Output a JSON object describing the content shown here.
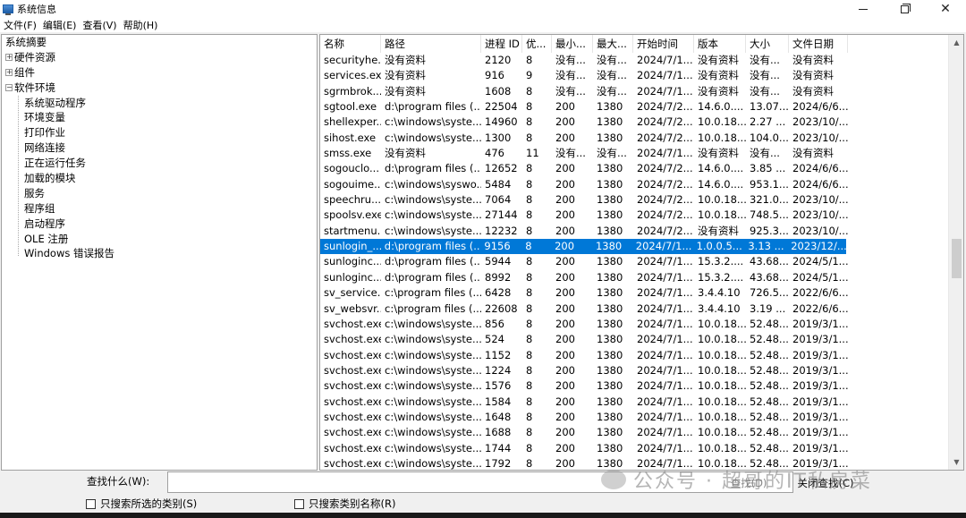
{
  "window": {
    "title": "系统信息",
    "minimize": "—",
    "restore": "❐",
    "close": "✕"
  },
  "menu": [
    "文件(F)",
    "编辑(E)",
    "查看(V)",
    "帮助(H)"
  ],
  "tree": [
    {
      "label": "系统摘要",
      "level": 0,
      "toggle": ""
    },
    {
      "label": "硬件资源",
      "level": 1,
      "toggle": "+"
    },
    {
      "label": "组件",
      "level": 1,
      "toggle": "+"
    },
    {
      "label": "软件环境",
      "level": 1,
      "toggle": "-"
    },
    {
      "label": "系统驱动程序",
      "level": 2,
      "toggle": ""
    },
    {
      "label": "环境变量",
      "level": 2,
      "toggle": ""
    },
    {
      "label": "打印作业",
      "level": 2,
      "toggle": ""
    },
    {
      "label": "网络连接",
      "level": 2,
      "toggle": ""
    },
    {
      "label": "正在运行任务",
      "level": 2,
      "toggle": ""
    },
    {
      "label": "加载的模块",
      "level": 2,
      "toggle": ""
    },
    {
      "label": "服务",
      "level": 2,
      "toggle": ""
    },
    {
      "label": "程序组",
      "level": 2,
      "toggle": ""
    },
    {
      "label": "启动程序",
      "level": 2,
      "toggle": ""
    },
    {
      "label": "OLE 注册",
      "level": 2,
      "toggle": ""
    },
    {
      "label": "Windows 错误报告",
      "level": 2,
      "toggle": ""
    }
  ],
  "columns": [
    "名称",
    "路径",
    "进程 ID",
    "优...",
    "最小...",
    "最大...",
    "开始时间",
    "版本",
    "大小",
    "文件日期"
  ],
  "rows": [
    [
      "securityhe...",
      "没有资料",
      "2120",
      "8",
      "没有...",
      "没有...",
      "2024/7/1...",
      "没有资料",
      "没有...",
      "没有资料"
    ],
    [
      "services.exe",
      "没有资料",
      "916",
      "9",
      "没有...",
      "没有...",
      "2024/7/1...",
      "没有资料",
      "没有...",
      "没有资料"
    ],
    [
      "sgrmbrok...",
      "没有资料",
      "1608",
      "8",
      "没有...",
      "没有...",
      "2024/7/1...",
      "没有资料",
      "没有...",
      "没有资料"
    ],
    [
      "sgtool.exe",
      "d:\\program files (...",
      "22504",
      "8",
      "200",
      "1380",
      "2024/7/2...",
      "14.6.0....",
      "13.07...",
      "2024/6/6..."
    ],
    [
      "shellexper...",
      "c:\\windows\\syste...",
      "14960",
      "8",
      "200",
      "1380",
      "2024/7/2...",
      "10.0.18...",
      "2.27 ...",
      "2023/10/..."
    ],
    [
      "sihost.exe",
      "c:\\windows\\syste...",
      "1300",
      "8",
      "200",
      "1380",
      "2024/7/2...",
      "10.0.18...",
      "104.0...",
      "2023/10/..."
    ],
    [
      "smss.exe",
      "没有资料",
      "476",
      "11",
      "没有...",
      "没有...",
      "2024/7/1...",
      "没有资料",
      "没有...",
      "没有资料"
    ],
    [
      "sogouclo...",
      "d:\\program files (...",
      "12652",
      "8",
      "200",
      "1380",
      "2024/7/2...",
      "14.6.0....",
      "3.85 ...",
      "2024/6/6..."
    ],
    [
      "sogouime...",
      "c:\\windows\\syswo...",
      "5484",
      "8",
      "200",
      "1380",
      "2024/7/2...",
      "14.6.0....",
      "953.1...",
      "2024/6/6..."
    ],
    [
      "speechru...",
      "c:\\windows\\syste...",
      "7064",
      "8",
      "200",
      "1380",
      "2024/7/2...",
      "10.0.18...",
      "321.0...",
      "2023/10/..."
    ],
    [
      "spoolsv.exe",
      "c:\\windows\\syste...",
      "27144",
      "8",
      "200",
      "1380",
      "2024/7/2...",
      "10.0.18...",
      "748.5...",
      "2023/10/..."
    ],
    [
      "startmenu...",
      "c:\\windows\\syste...",
      "12232",
      "8",
      "200",
      "1380",
      "2024/7/2...",
      "没有资料",
      "925.3...",
      "2023/10/..."
    ],
    [
      "sunlogin_...",
      "d:\\program files (...",
      "9156",
      "8",
      "200",
      "1380",
      "2024/7/1...",
      "1.0.0.5...",
      "3.13 ...",
      "2023/12/..."
    ],
    [
      "sunloginc...",
      "d:\\program files (...",
      "5944",
      "8",
      "200",
      "1380",
      "2024/7/1...",
      "15.3.2....",
      "43.68...",
      "2024/5/1..."
    ],
    [
      "sunloginc...",
      "d:\\program files (...",
      "8992",
      "8",
      "200",
      "1380",
      "2024/7/1...",
      "15.3.2....",
      "43.68...",
      "2024/5/1..."
    ],
    [
      "sv_service...",
      "c:\\program files (...",
      "6428",
      "8",
      "200",
      "1380",
      "2024/7/1...",
      "3.4.4.10",
      "726.5...",
      "2022/6/6..."
    ],
    [
      "sv_websvr...",
      "c:\\program files (...",
      "22608",
      "8",
      "200",
      "1380",
      "2024/7/1...",
      "3.4.4.10",
      "3.19 ...",
      "2022/6/6..."
    ],
    [
      "svchost.exe",
      "c:\\windows\\syste...",
      "856",
      "8",
      "200",
      "1380",
      "2024/7/1...",
      "10.0.18...",
      "52.48...",
      "2019/3/1..."
    ],
    [
      "svchost.exe",
      "c:\\windows\\syste...",
      "524",
      "8",
      "200",
      "1380",
      "2024/7/1...",
      "10.0.18...",
      "52.48...",
      "2019/3/1..."
    ],
    [
      "svchost.exe",
      "c:\\windows\\syste...",
      "1152",
      "8",
      "200",
      "1380",
      "2024/7/1...",
      "10.0.18...",
      "52.48...",
      "2019/3/1..."
    ],
    [
      "svchost.exe",
      "c:\\windows\\syste...",
      "1224",
      "8",
      "200",
      "1380",
      "2024/7/1...",
      "10.0.18...",
      "52.48...",
      "2019/3/1..."
    ],
    [
      "svchost.exe",
      "c:\\windows\\syste...",
      "1576",
      "8",
      "200",
      "1380",
      "2024/7/1...",
      "10.0.18...",
      "52.48...",
      "2019/3/1..."
    ],
    [
      "svchost.exe",
      "c:\\windows\\syste...",
      "1584",
      "8",
      "200",
      "1380",
      "2024/7/1...",
      "10.0.18...",
      "52.48...",
      "2019/3/1..."
    ],
    [
      "svchost.exe",
      "c:\\windows\\syste...",
      "1648",
      "8",
      "200",
      "1380",
      "2024/7/1...",
      "10.0.18...",
      "52.48...",
      "2019/3/1..."
    ],
    [
      "svchost.exe",
      "c:\\windows\\syste...",
      "1688",
      "8",
      "200",
      "1380",
      "2024/7/1...",
      "10.0.18...",
      "52.48...",
      "2019/3/1..."
    ],
    [
      "svchost.exe",
      "c:\\windows\\syste...",
      "1744",
      "8",
      "200",
      "1380",
      "2024/7/1...",
      "10.0.18...",
      "52.48...",
      "2019/3/1..."
    ],
    [
      "svchost.exe",
      "c:\\windows\\syste...",
      "1792",
      "8",
      "200",
      "1380",
      "2024/7/1...",
      "10.0.18...",
      "52.48...",
      "2019/3/1..."
    ]
  ],
  "selected_row": 12,
  "search": {
    "label": "查找什么(W):",
    "value": "",
    "find_button": "查找(D)",
    "close_find_button": "关闭查找(C)",
    "option_selected_category": "只搜索所选的类别(S)",
    "option_category_names": "只搜索类别名称(R)"
  },
  "watermark": "公众号 · 超哥的IT私房菜",
  "colors": {
    "selection": "#0078d7",
    "panel_border": "#a0a0a0",
    "window_bg": "#f0f0f0"
  }
}
